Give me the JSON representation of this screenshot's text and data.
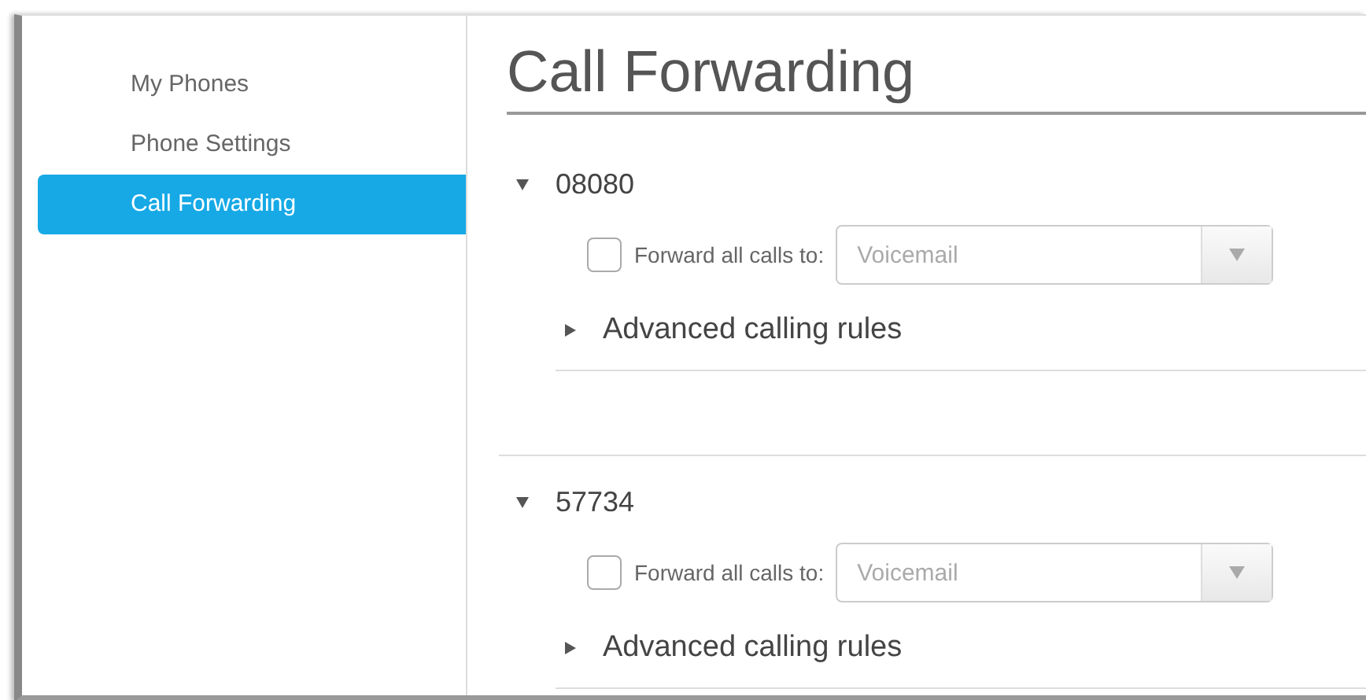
{
  "sidebar": {
    "items": [
      {
        "label": "My Phones",
        "selected": false
      },
      {
        "label": "Phone Settings",
        "selected": false
      },
      {
        "label": "Call Forwarding",
        "selected": true
      }
    ]
  },
  "page": {
    "title": "Call Forwarding"
  },
  "lines": [
    {
      "number": "08080",
      "expanded": true,
      "forward": {
        "label": "Forward all calls to:",
        "checked": false,
        "value": "Voicemail"
      },
      "advanced": {
        "label": "Advanced calling rules",
        "expanded": false
      }
    },
    {
      "number": "57734",
      "expanded": true,
      "forward": {
        "label": "Forward all calls to:",
        "checked": false,
        "value": "Voicemail"
      },
      "advanced": {
        "label": "Advanced calling rules",
        "expanded": false
      }
    }
  ]
}
